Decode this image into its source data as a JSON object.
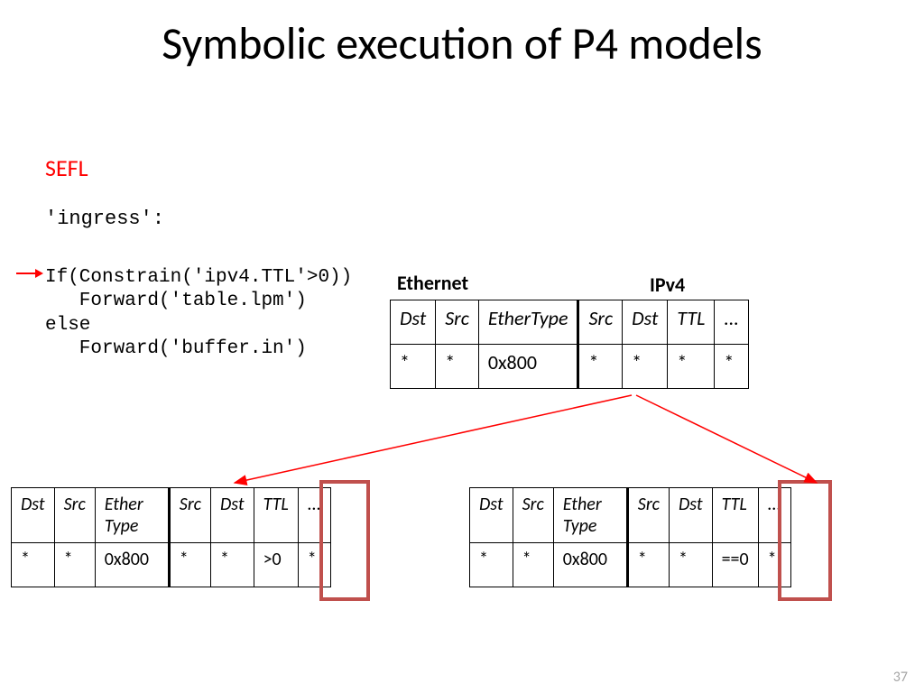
{
  "title": "Symbolic execution of P4 models",
  "sefl_label": "SEFL",
  "ingress_label": "'ingress':",
  "code": "If(Constrain('ipv4.TTL'>0))\n   Forward('table.lpm')\nelse\n   Forward('buffer.in')",
  "labels": {
    "ethernet": "Ethernet",
    "ipv4": "IPv4"
  },
  "top_table": {
    "headers": [
      "Dst",
      "Src",
      "EtherType",
      "Src",
      "Dst",
      "TTL",
      "..."
    ],
    "values": [
      "*",
      "*",
      "0x800",
      "*",
      "*",
      "*",
      "*"
    ]
  },
  "bl_table": {
    "headers": [
      "Dst",
      "Src",
      "Ether Type",
      "Src",
      "Dst",
      "TTL",
      "..."
    ],
    "values": [
      "*",
      "*",
      "0x800",
      "*",
      "*",
      ">0",
      "*"
    ]
  },
  "br_table": {
    "headers": [
      "Dst",
      "Src",
      "Ether Type",
      "Src",
      "Dst",
      "TTL",
      "..."
    ],
    "values": [
      "*",
      "*",
      "0x800",
      "*",
      "*",
      "==0",
      "*"
    ]
  },
  "page_number": "37"
}
